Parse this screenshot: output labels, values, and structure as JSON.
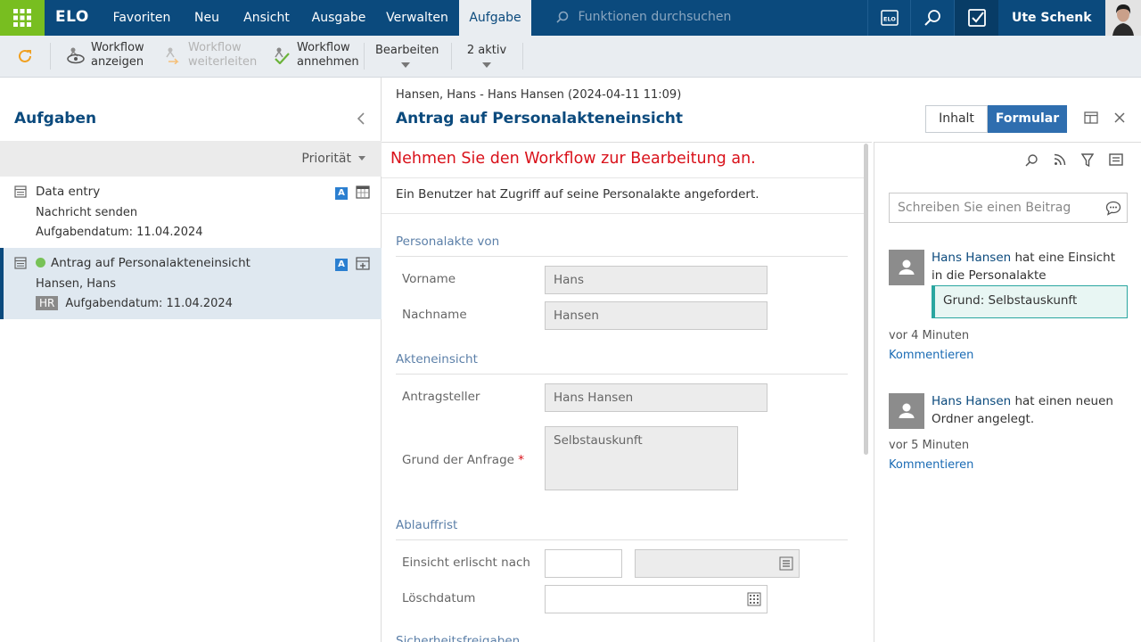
{
  "topbar": {
    "logo": "ELO",
    "nav": [
      "Favoriten",
      "Neu",
      "Ansicht",
      "Ausgabe",
      "Verwalten",
      "Aufgabe"
    ],
    "active_nav": "Aufgabe",
    "search_placeholder": "Funktionen durchsuchen",
    "user_name": "Ute Schenk",
    "colors": {
      "bar": "#0b4a7d",
      "apps": "#78be20"
    }
  },
  "ribbon": {
    "refresh_icon": "refresh-icon",
    "show_workflow": [
      "Workflow",
      "anzeigen"
    ],
    "forward_workflow": [
      "Workflow",
      "weiterleiten"
    ],
    "accept_workflow": [
      "Workflow",
      "annehmen"
    ],
    "edit": "Bearbeiten",
    "active": "2 aktiv"
  },
  "tasks_panel": {
    "title": "Aufgaben",
    "sort_label": "Priorität",
    "tasks": [
      {
        "title": "Data entry",
        "subtitle": "Nachricht senden",
        "date": "Aufgabendatum: 11.04.2024",
        "badge": "A"
      },
      {
        "title": "Antrag auf Personalakteneinsicht",
        "subtitle": "Hansen, Hans",
        "tag": "HR",
        "date": "Aufgabendatum: 11.04.2024",
        "badge": "A"
      }
    ]
  },
  "document": {
    "breadcrumb": "Hansen, Hans - Hans Hansen (2024-04-11 11:09)",
    "title": "Antrag auf Personalakteneinsicht",
    "tabs": [
      "Inhalt",
      "Formular"
    ],
    "active_tab": "Formular"
  },
  "form": {
    "warning": "Nehmen Sie den Workflow zur Bearbeitung an.",
    "description": "Ein Benutzer hat Zugriff auf seine Personalakte angefordert.",
    "sections": {
      "personalakte": "Personalakte von",
      "akteneinsicht": "Akteneinsicht",
      "ablauffrist": "Ablauffrist",
      "sicherheit": "Sicherheitsfreigaben"
    },
    "fields": {
      "vorname_label": "Vorname",
      "vorname": "Hans",
      "nachname_label": "Nachname",
      "nachname": "Hansen",
      "antragsteller_label": "Antragsteller",
      "antragsteller": "Hans Hansen",
      "grund_label": "Grund der Anfrage",
      "grund": "Selbstauskunft",
      "required_mark": "*",
      "erlischt_label": "Einsicht erlischt nach",
      "erlischt": "",
      "erlischt_unit": "",
      "loeschdatum_label": "Löschdatum",
      "loeschdatum": ""
    }
  },
  "feed": {
    "post_placeholder": "Schreiben Sie einen Beitrag",
    "entries": [
      {
        "name": "Hans Hansen",
        "text": " hat eine Einsicht in die Personalakte angefordert.",
        "quote": "Grund: Selbstauskunft",
        "time": "vor 4 Minuten",
        "link": "Kommentieren"
      },
      {
        "name": "Hans Hansen",
        "text": " hat einen neuen Ordner angelegt.",
        "time": "vor 5 Minuten",
        "link": "Kommentieren"
      }
    ]
  }
}
